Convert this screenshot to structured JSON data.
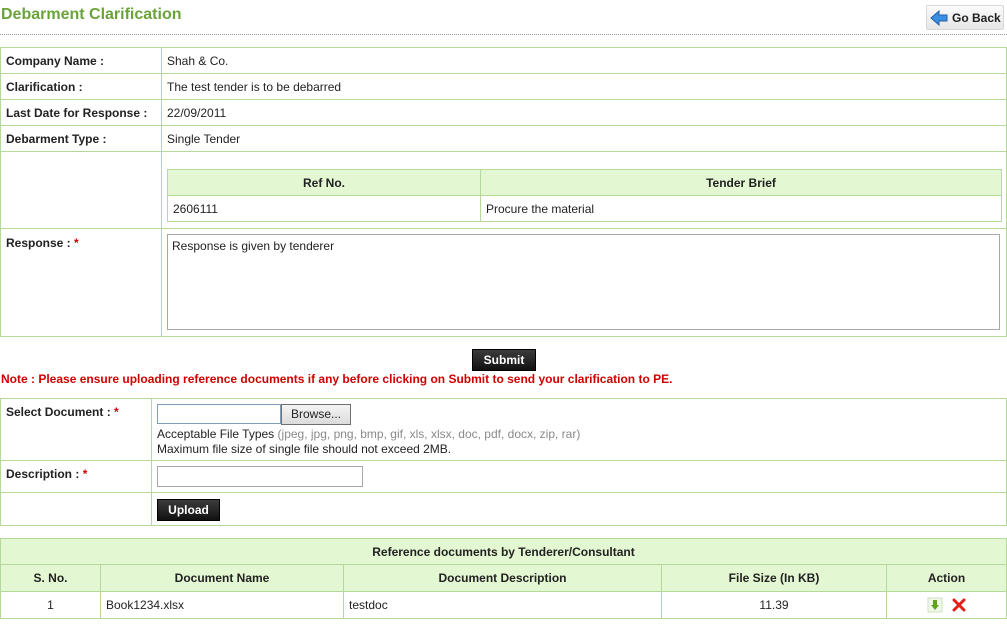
{
  "header": {
    "title": "Debarment Clarification",
    "go_back_label": "Go Back"
  },
  "details": {
    "company_name_label": "Company Name :",
    "company_name_value": "Shah & Co.",
    "clarification_label": "Clarification :",
    "clarification_value": "The test tender is to be debarred",
    "last_date_label": "Last Date for Response :",
    "last_date_value": "22/09/2011",
    "debarment_type_label": "Debarment Type :",
    "debarment_type_value": "Single Tender"
  },
  "tender_table": {
    "headers": [
      "Ref No.",
      "Tender Brief"
    ],
    "rows": [
      [
        "2606111",
        "Procure the material"
      ]
    ]
  },
  "response": {
    "label": "Response :",
    "required_mark": "*",
    "value": "Response is given by tenderer"
  },
  "submit_label": "Submit",
  "note": "Note : Please ensure uploading reference documents if any before clicking on Submit to send your clarification to PE.",
  "upload": {
    "select_label": "Select Document :",
    "required_mark": "*",
    "browse_label": "Browse...",
    "acceptable_prefix": "Acceptable File Types",
    "acceptable_types": "(jpeg, jpg, png, bmp, gif, xls, xlsx, doc, pdf, docx, zip, rar)",
    "max_size_note": "Maximum file size of single file should not exceed 2MB.",
    "description_label": "Description :",
    "upload_label": "Upload"
  },
  "documents": {
    "title": "Reference documents by Tenderer/Consultant",
    "headers": [
      "S. No.",
      "Document Name",
      "Document Description",
      "File Size (In KB)",
      "Action"
    ],
    "rows": [
      {
        "sno": "1",
        "name": "Book1234.xlsx",
        "description": "testdoc",
        "size": "11.39"
      }
    ],
    "colors": {
      "download": "#5da31f",
      "delete": "#e0201a"
    }
  }
}
